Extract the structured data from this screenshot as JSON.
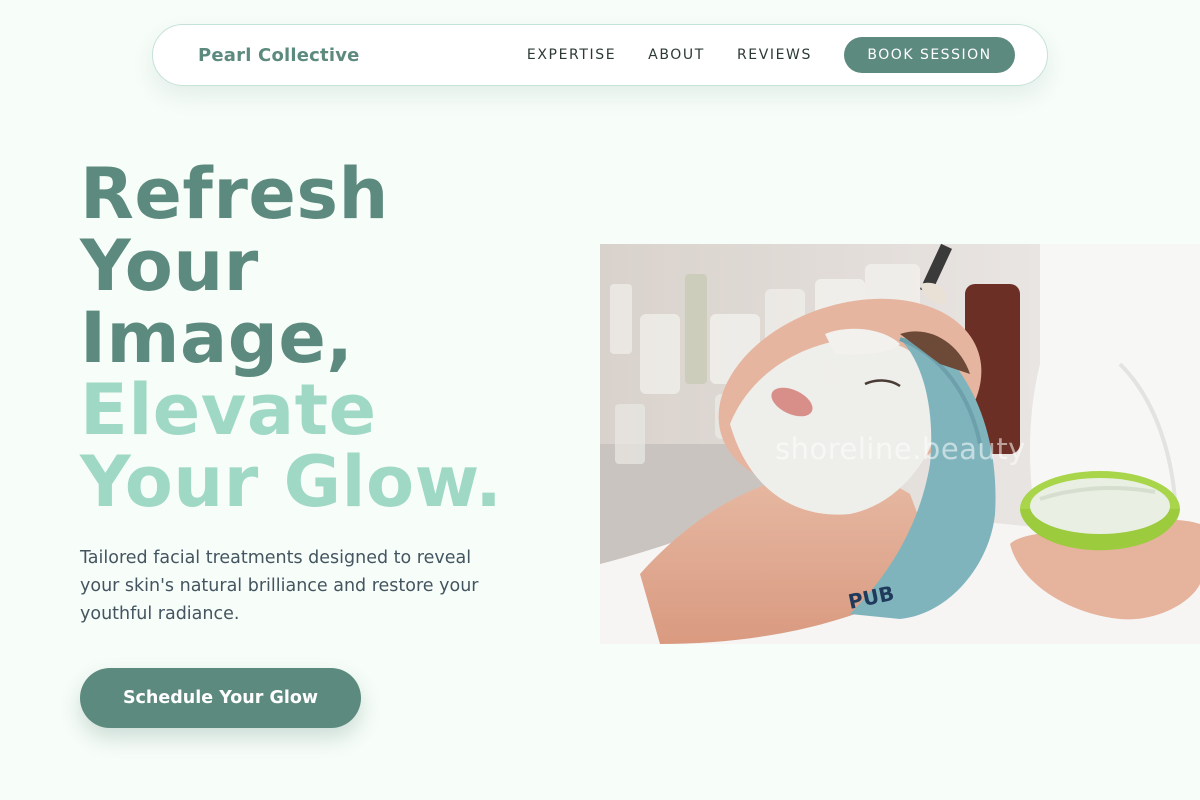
{
  "nav": {
    "brand": "Pearl Collective",
    "links": [
      "EXPERTISE",
      "ABOUT",
      "REVIEWS"
    ],
    "cta": "BOOK SESSION"
  },
  "hero": {
    "title_lines": [
      "Refresh",
      "Your",
      "Image,",
      "Elevate",
      "Your Glow."
    ],
    "description": "Tailored facial treatments designed to reveal your skin's natural brilliance and restore your youthful radiance.",
    "cta": "Schedule Your Glow",
    "image_watermark": "shoreline.beauty",
    "headband_text": "PUB"
  },
  "colors": {
    "accent": "#5d8a7e",
    "accent_light": "#9fd9c5",
    "background": "#f7fdf9",
    "body_text": "#445560"
  }
}
